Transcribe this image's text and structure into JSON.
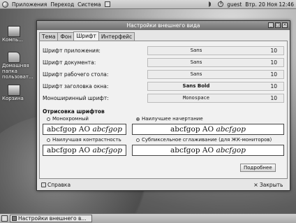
{
  "top_panel": {
    "menus": [
      "Приложения",
      "Переход",
      "Система"
    ],
    "user": "guest",
    "clock": "Втр. 20 Ноя 12:46"
  },
  "desktop_icons": [
    {
      "label": "Компь..."
    },
    {
      "label": "Домашняя папка пользоват..."
    },
    {
      "label": "Корзина"
    }
  ],
  "window": {
    "title": "Настройки внешнего вида",
    "tabs": [
      "Тема",
      "Фон",
      "Шрифт",
      "Интерфейс"
    ],
    "active_tab": "Шрифт",
    "fonts": [
      {
        "label": "Шрифт приложения:",
        "font": "Sans",
        "size": "10"
      },
      {
        "label": "Шрифт документа:",
        "font": "Sans",
        "size": "10"
      },
      {
        "label": "Шрифт рабочего стола:",
        "font": "Sans",
        "size": "10"
      },
      {
        "label": "Шрифт заголовка окна:",
        "font": "Sans Bold",
        "size": "10"
      },
      {
        "label": "Моноширинный шрифт:",
        "font": "Monospace",
        "size": "10"
      }
    ],
    "rendering": {
      "title": "Отрисовка шрифтов",
      "options": [
        {
          "label": "Монохромный",
          "selected": false,
          "sample_plain": "abcfgop AO ",
          "sample_italic": "abcfgop"
        },
        {
          "label": "Наилучшее начертание",
          "selected": true,
          "sample_plain": "abcfgop AO ",
          "sample_italic": "abcfgop"
        },
        {
          "label": "Наилучшая контрастность",
          "selected": false,
          "sample_plain": "abcfgop AO ",
          "sample_italic": "abcfgop"
        },
        {
          "label": "Субпиксельное сглаживание (для ЖК-мониторов)",
          "selected": false,
          "sample_plain": "abcfgop AO ",
          "sample_italic": "abcfgop"
        }
      ]
    },
    "details_button": "Подробнее",
    "help_button": "Справка",
    "close_button": "Закрыть"
  },
  "taskbar": {
    "task_label": "Настройки внешнего в..."
  }
}
